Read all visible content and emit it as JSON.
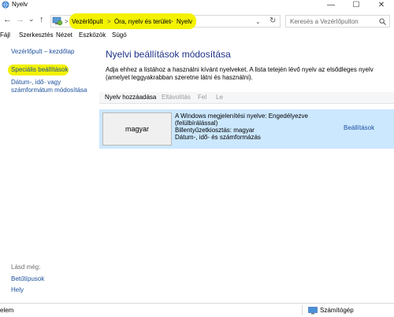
{
  "window": {
    "title": "Nyelv",
    "minimize": "—",
    "maximize": "☐",
    "close": "✕"
  },
  "nav": {
    "back": "←",
    "forward": "→",
    "recent": "⌄",
    "up": "↑",
    "breadcrumbs": [
      "Vezérlőpult",
      "Óra, nyelv és terület",
      "Nyelv"
    ],
    "separator": ">",
    "dropdown": "⌄",
    "refresh": "↻",
    "search_placeholder": "Keresés a Vezérlőpulton"
  },
  "menu": [
    "Fájl",
    "Szerkesztés",
    "Nézet",
    "Eszközök",
    "Súgó"
  ],
  "sidebar": {
    "items": [
      "Vezérlőpult – kezdőlap",
      "Speciális beállítások",
      "Dátum-, idő- vagy számformátum módosítása"
    ],
    "see_also_label": "Lásd még:",
    "see_also": [
      "Betűtípusok",
      "Hely"
    ]
  },
  "main": {
    "title": "Nyelvi beállítások módosítása",
    "description": "Adja ehhez a listához a használni kívánt nyelveket. A lista tetején lévő nyelv az elsődleges nyelv (amelyet leggyakrabban szeretne látni és használni).",
    "toolbar": {
      "add": "Nyelv hozzáadása",
      "remove": "Eltávolítás",
      "up": "Fel",
      "down": "Le"
    },
    "language": {
      "name": "magyar",
      "info": [
        "A Windows megjelenítési nyelve: Engedélyezve",
        "(felülbírálással)",
        "Billentyűzetkiosztás: magyar",
        "Dátum-, idő- és számformázás"
      ],
      "settings": "Beállítások"
    }
  },
  "status": {
    "left": "elem",
    "right": "Számítógép"
  },
  "colors": {
    "highlight": "#f3f200",
    "selection": "#cce8ff",
    "link": "#1b4f9c",
    "title": "#1e3287"
  }
}
